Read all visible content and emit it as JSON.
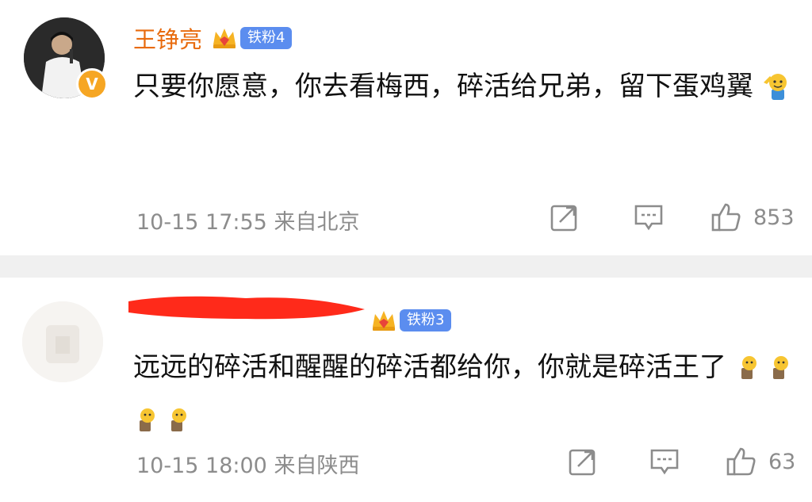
{
  "comments": [
    {
      "username": "王铮亮",
      "fan_badge": "铁粉4",
      "verified_badge": "V",
      "text": "只要你愿意，你去看梅西，碎活给兄弟，留下蛋鸡翼",
      "emojis": [
        "salute-emoji"
      ],
      "time": "10-15 17:55",
      "location": "来自北京",
      "likes": "853"
    },
    {
      "username": "",
      "fan_badge": "铁粉3",
      "text": "远远的碎活和醒醒的碎活都给你，你就是碎活王了",
      "emojis": [
        "doge-emoji",
        "doge-emoji",
        "doge-emoji",
        "doge-emoji"
      ],
      "time": "10-15 18:00",
      "location": "来自陕西",
      "likes": "63"
    }
  ],
  "colors": {
    "username": "#e86b0e",
    "fan_badge": "#5b8def",
    "meta_gray": "#8c8c8c",
    "divider": "#f0f0f0",
    "verified": "#f6a623",
    "redaction": "#ff2a1a"
  }
}
